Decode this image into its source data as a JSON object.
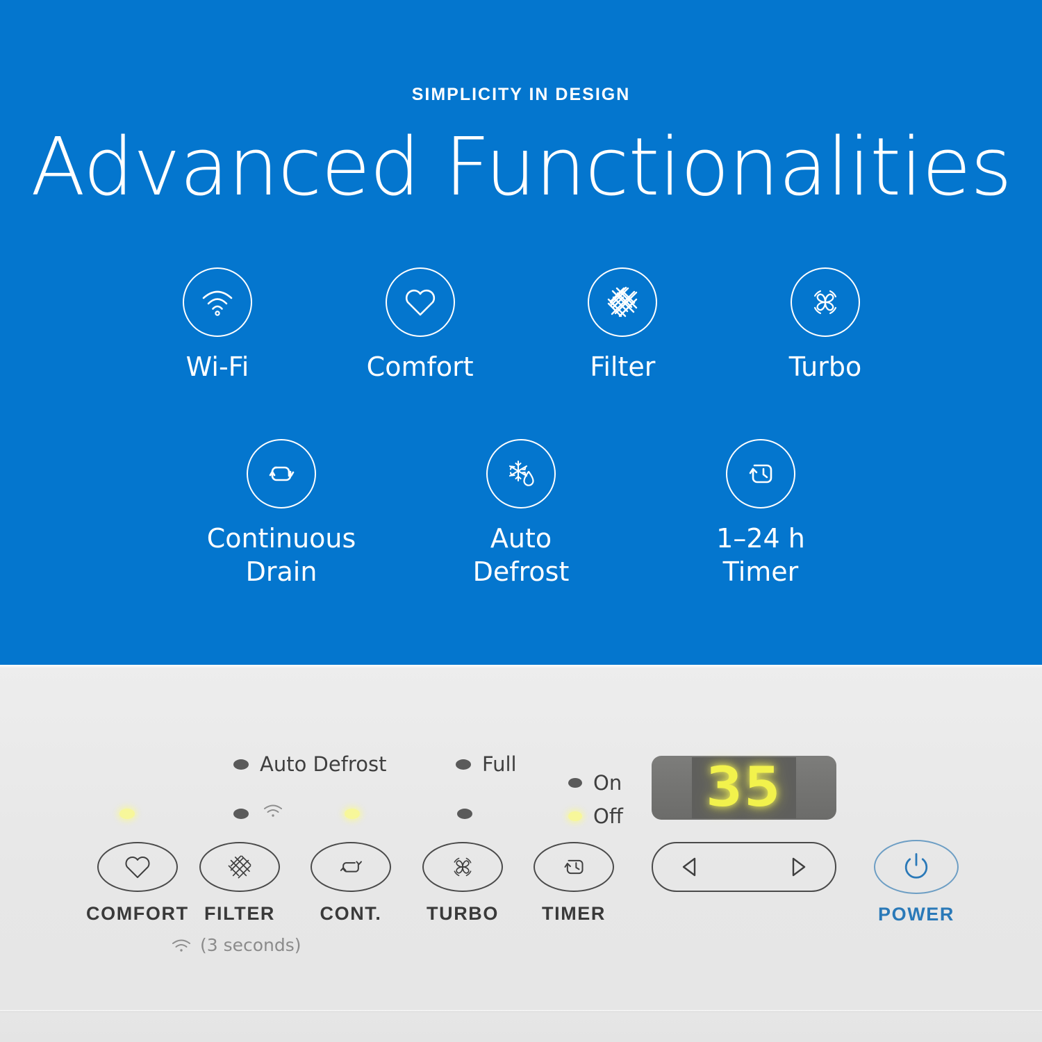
{
  "hero": {
    "eyebrow": "SIMPLICITY IN DESIGN",
    "headline": "Advanced Functionalities",
    "bg_color": "#0476CE",
    "text_color": "#FFFFFF",
    "features_row1": [
      {
        "icon": "wifi-icon",
        "label": "Wi-Fi"
      },
      {
        "icon": "heart-icon",
        "label": "Comfort"
      },
      {
        "icon": "filter-mesh-icon",
        "label": "Filter"
      },
      {
        "icon": "fan-turbo-icon",
        "label": "Turbo"
      }
    ],
    "features_row2": [
      {
        "icon": "loop-drain-icon",
        "label": "Continuous\nDrain"
      },
      {
        "icon": "snowflake-drop-icon",
        "label": "Auto\nDefrost"
      },
      {
        "icon": "clock-timer-icon",
        "label": "1–24 h\nTimer"
      }
    ]
  },
  "panel": {
    "status_indicators": [
      {
        "name": "auto-defrost",
        "label": "Auto Defrost",
        "lit": false
      },
      {
        "name": "full",
        "label": "Full",
        "lit": false
      },
      {
        "name": "timer-on",
        "label": "On",
        "lit": false
      },
      {
        "name": "timer-off",
        "label": "Off",
        "lit": true
      }
    ],
    "button_leds": [
      {
        "name": "comfort-led",
        "lit": true
      },
      {
        "name": "filter-led",
        "lit": false
      },
      {
        "name": "cont-led",
        "lit": true
      },
      {
        "name": "turbo-led",
        "lit": false
      }
    ],
    "display": {
      "value": "35",
      "digit_color": "#F2F24C",
      "bezel_color": "#757573"
    },
    "buttons": [
      {
        "name": "comfort-button",
        "icon": "heart-icon",
        "label": "COMFORT"
      },
      {
        "name": "filter-button",
        "icon": "filter-mesh-icon",
        "label": "FILTER"
      },
      {
        "name": "cont-button",
        "icon": "loop-drain-icon",
        "label": "CONT."
      },
      {
        "name": "turbo-button",
        "icon": "fan-turbo-icon",
        "label": "TURBO"
      },
      {
        "name": "timer-button",
        "icon": "clock-timer-icon",
        "label": "TIMER"
      }
    ],
    "arrow_pad": {
      "left_icon": "triangle-left-icon",
      "right_icon": "triangle-right-icon"
    },
    "power": {
      "label": "POWER",
      "icon": "power-icon",
      "color": "#2A79B8"
    },
    "wifi_note": {
      "icon": "wifi-icon",
      "text": "(3 seconds)"
    }
  }
}
